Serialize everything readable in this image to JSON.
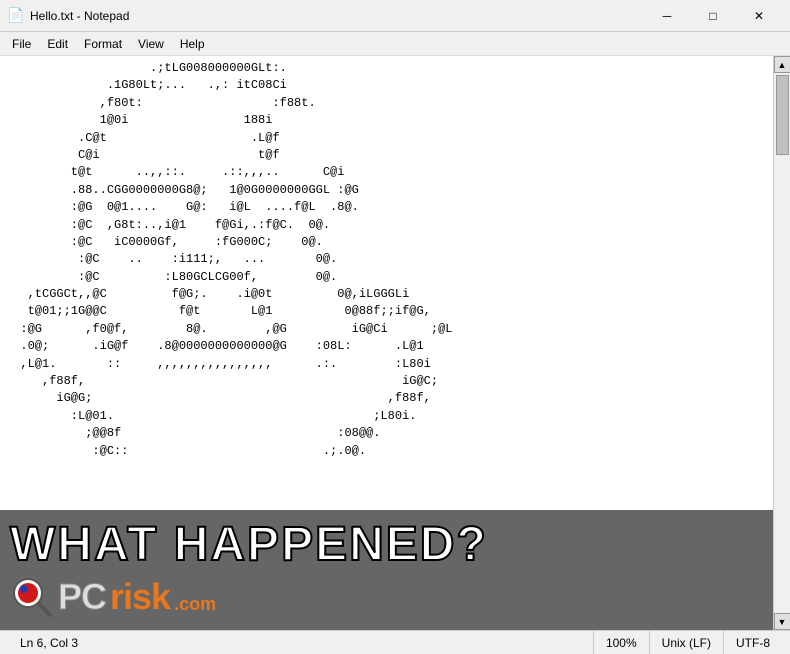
{
  "window": {
    "title": "Hello.txt - Notepad",
    "icon": "📄"
  },
  "titlebar": {
    "minimize_label": "─",
    "maximize_label": "□",
    "close_label": "✕"
  },
  "menubar": {
    "items": [
      "File",
      "Edit",
      "Format",
      "View",
      "Help"
    ]
  },
  "editor": {
    "content": "                    .;tLG008000000GLt:.\n              .1G80Lt;...   .,: itC08Ci\n             ,f80t:                  :f88t.\n             1@0i                188i\n          .C@t                    .L@f\n          C@i                      t@f\n         t@t      ..,,::.     .::,,,..      C@i\n         .88..CGG0000000G8@;   1@0G0000000GGL :@G\n         :@G  0@1....    G@:   i@L  ....f@L  .8@.\n         :@C  ,G8t:..,i@1    f@Gi,.:f@C.  0@.\n         :@C   iC0000Gf,     :fG000C;    0@.\n          :@C    ..    :i111;,   ...       0@.\n          :@C         :L80GCLCG00f,        0@.\n   ,tCGGCt,,@C         f@G;.    .i@0t         0@,iLGGGLi\n   t@01;;1G@@C          f@t       L@1          0@88f;;if@G,\n  :@G      ,f0@f,        8@.        ,@G         iG@Ci      ;@L\n  .0@;      .iG@f    .8@0000000000000@G    :08L:      .L@1\n  ,L@1.       ::     ,,,,,,,,,,,,,,,,      .:.        :L80i\n     ,f88f,                                            iG@C;\n       iG@G;                                         ,f88f,\n         :L@01.                                    ;L80i.\n           ;@@8f                              :08@@.\n            :@C::                           .;.0@.",
    "cursor_line": 6,
    "cursor_col": 3
  },
  "statusbar": {
    "position": "Ln 6, Col 3",
    "zoom": "100%",
    "line_endings": "Unix (LF)",
    "encoding": "UTF-8"
  },
  "watermark": {
    "headline": "WHAT HAPPENED?",
    "logo_pc": "PC",
    "logo_risk": "risk",
    "logo_dot_com": ".com"
  }
}
